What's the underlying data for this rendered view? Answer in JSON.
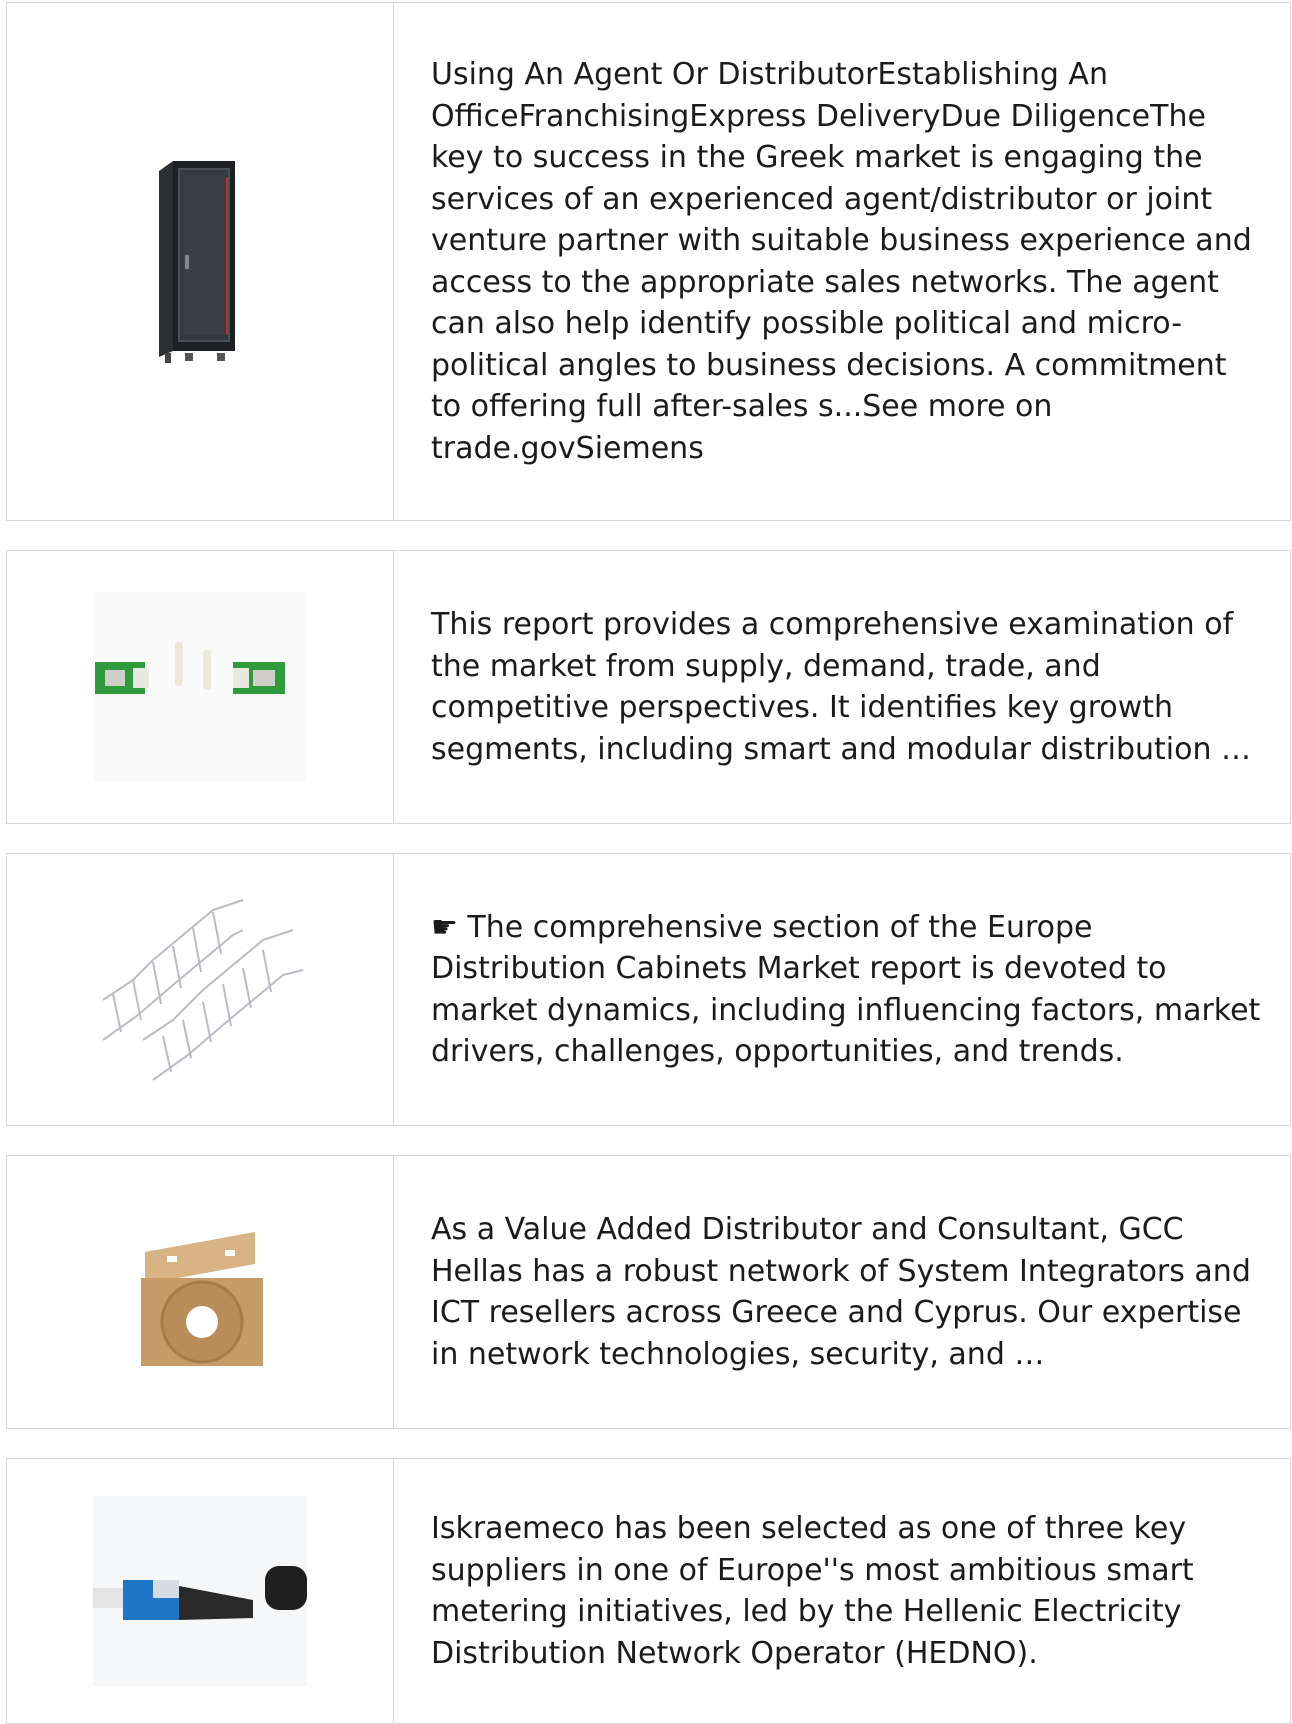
{
  "items": [
    {
      "image": "server-rack-cabinet",
      "text": "Using An Agent Or DistributorEstablishing An OfficeFranchisingExpress DeliveryDue DiligenceThe key to success in the Greek market is engaging the services of an experienced agent/distributor or joint venture partner with suitable business experience and access to the appropriate sales networks. The agent can also help identify possible political and micro-political angles to business decisions. A commitment to offering full after-sales s...See more on trade.govSiemens"
    },
    {
      "image": "fiber-adapter-connectors",
      "text": "This report provides a comprehensive examination of the market from supply, demand, trade, and competitive perspectives. It identifies key growth segments, including smart and modular distribution …"
    },
    {
      "image": "wire-mesh-cable-tray",
      "text": "☛ The comprehensive section of the Europe Distribution Cabinets Market report is devoted to market dynamics, including influencing factors, market drivers, challenges, opportunities, and trends."
    },
    {
      "image": "cable-spool-box",
      "text": "As a Value Added Distributor and Consultant, GCC Hellas has a robust network of System Integrators and ICT resellers across Greece and Cyprus. Our expertise in network technologies, security, and …"
    },
    {
      "image": "fiber-fast-connector",
      "text": "Iskraemeco has been selected as one of three key suppliers in one of Europe''s most ambitious smart metering initiatives, led by the Hellenic Electricity Distribution Network Operator (HEDNO)."
    }
  ]
}
